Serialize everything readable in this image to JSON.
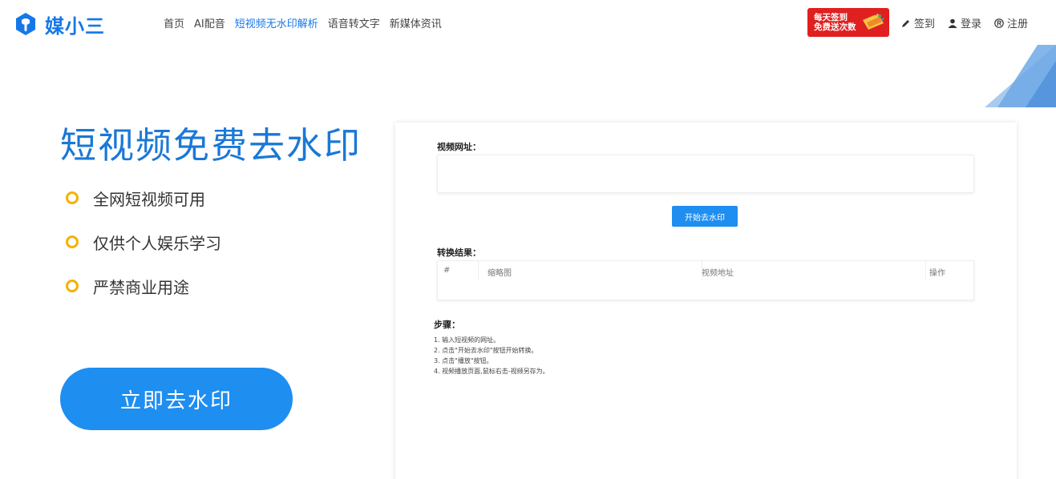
{
  "brand": {
    "name": "媒小三"
  },
  "nav": {
    "items": [
      {
        "label": "首页",
        "active": false
      },
      {
        "label": "AI配音",
        "active": false
      },
      {
        "label": "短视频无水印解析",
        "active": true
      },
      {
        "label": "语音转文字",
        "active": false
      },
      {
        "label": "新媒体资讯",
        "active": false
      }
    ]
  },
  "promo": {
    "line1": "每天签到",
    "line2": "免费送次数"
  },
  "user": {
    "signin": "签到",
    "login": "登录",
    "register": "注册"
  },
  "hero": {
    "title": "短视频免费去水印",
    "features": [
      "全网短视频可用",
      "仅供个人娱乐学习",
      "严禁商业用途"
    ],
    "cta_label": "立即去水印"
  },
  "tool": {
    "url_label": "视频网址：",
    "url_value": "",
    "url_placeholder": "",
    "start_button": "开始去水印",
    "result_label": "转换结果：",
    "columns": [
      "#",
      "缩略图",
      "视频地址",
      "操作"
    ],
    "steps_title": "步骤：",
    "steps": [
      "1. 输入短视频的网址。",
      "2. 点击\"开始去水印\"按钮开始转换。",
      "3. 点击\"播放\"按钮。",
      "4. 视频播放页面,鼠标右击-视频另存为。"
    ]
  },
  "colors": {
    "accent": "#1e8ef0",
    "title_blue": "#1a78d6",
    "ring": "#f5b100",
    "promo_red": "#e02020"
  }
}
